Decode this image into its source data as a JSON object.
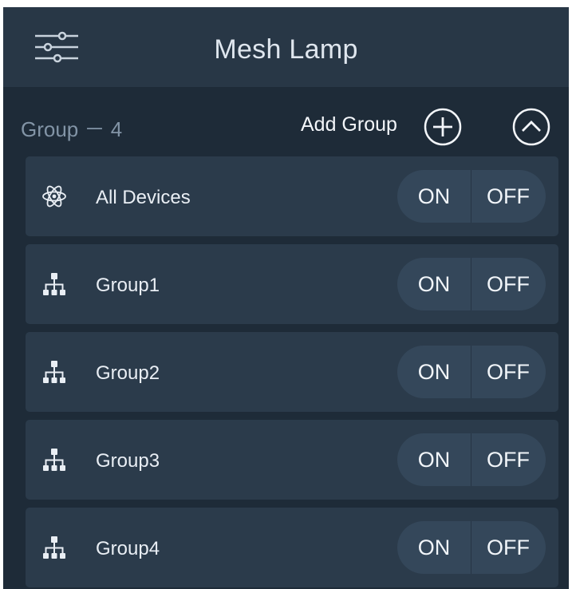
{
  "header": {
    "title": "Mesh Lamp",
    "menu_icon": "sliders-menu-icon"
  },
  "group_bar": {
    "count_label": "Group － 4",
    "add_label": "Add Group",
    "add_icon": "plus-circle-icon",
    "collapse_icon": "chevron-up-circle-icon"
  },
  "rows": [
    {
      "label": "All Devices",
      "icon": "atom-icon",
      "on_label": "ON",
      "off_label": "OFF"
    },
    {
      "label": "Group1",
      "icon": "hierarchy-icon",
      "on_label": "ON",
      "off_label": "OFF"
    },
    {
      "label": "Group2",
      "icon": "hierarchy-icon",
      "on_label": "ON",
      "off_label": "OFF"
    },
    {
      "label": "Group3",
      "icon": "hierarchy-icon",
      "on_label": "ON",
      "off_label": "OFF"
    },
    {
      "label": "Group4",
      "icon": "hierarchy-icon",
      "on_label": "ON",
      "off_label": "OFF"
    }
  ],
  "colors": {
    "background": "#1e2b38",
    "header": "#283746",
    "row": "#2b3b4b",
    "toggle": "#34475a"
  }
}
